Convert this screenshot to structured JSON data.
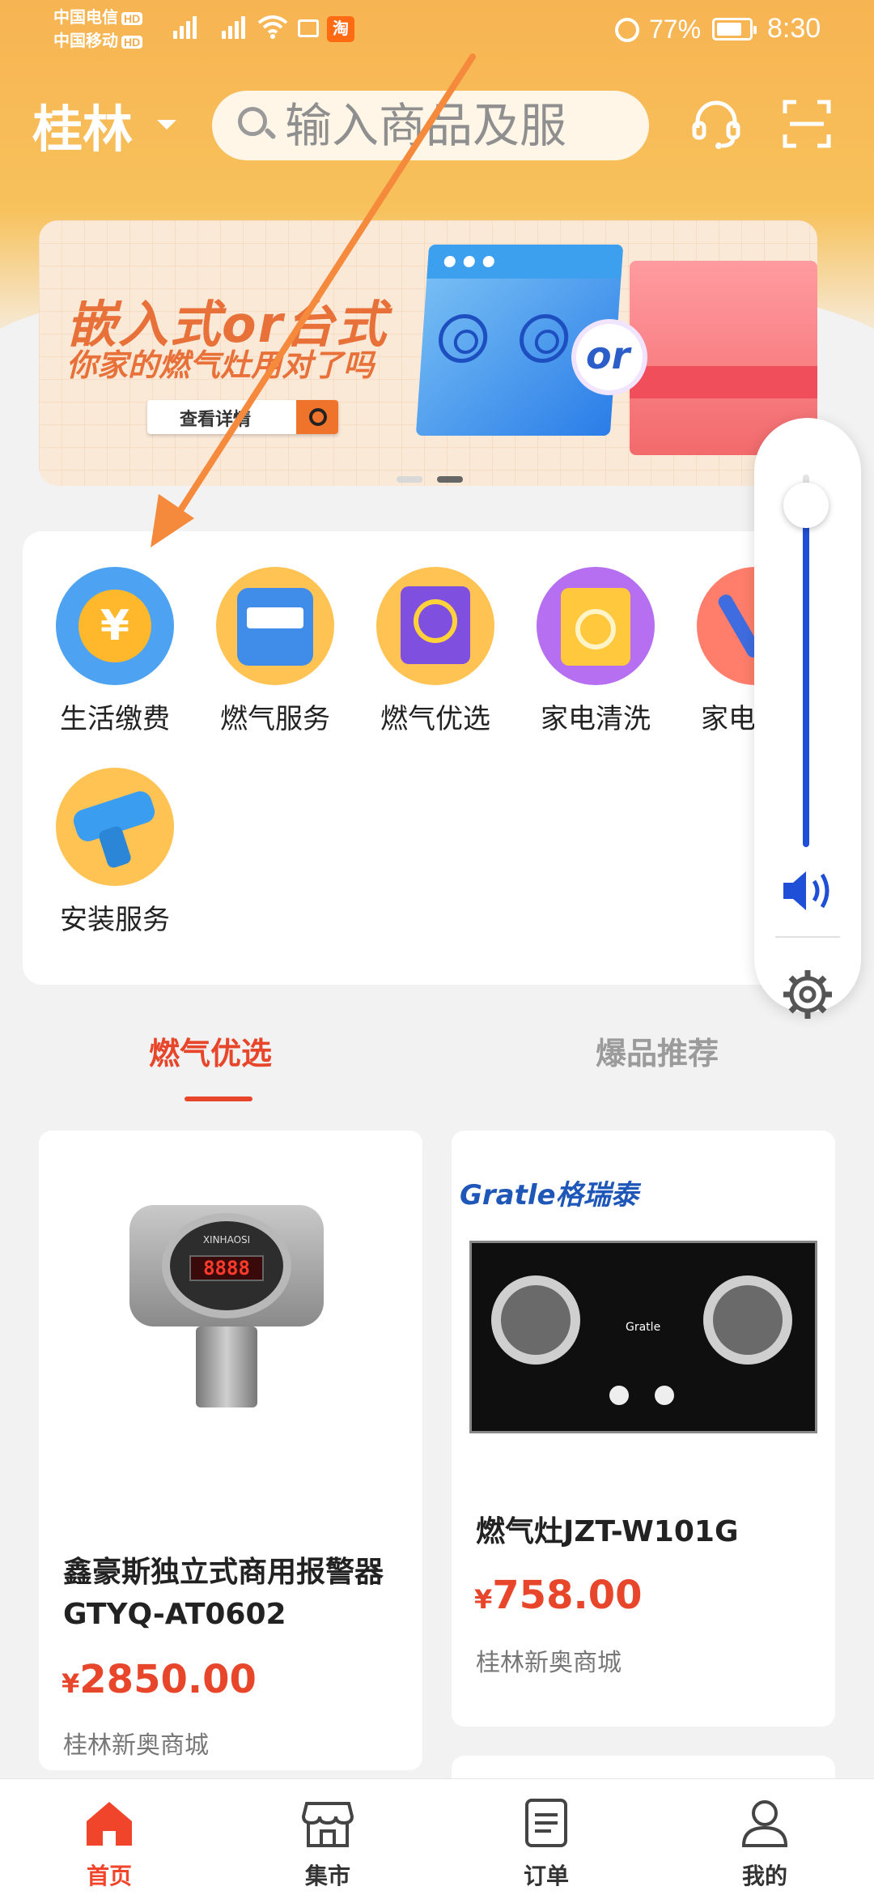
{
  "status_bar": {
    "carrier1": "中国电信",
    "carrier2": "中国移动",
    "hd": "HD",
    "taobao_glyph": "淘",
    "battery": "77%",
    "time": "8:30"
  },
  "header": {
    "city": "桂林",
    "search_placeholder": "输入商品及服",
    "icons": [
      "headset-icon",
      "scan-icon"
    ]
  },
  "banner": {
    "headline": "嵌入式or台式",
    "subline": "你家的燃气灶用对了吗",
    "button_label": "查看详情",
    "or_badge": "or",
    "page_count": 2,
    "active_page": 2
  },
  "categories": [
    {
      "label": "生活缴费",
      "icon": "yuan-icon"
    },
    {
      "label": "燃气服务",
      "icon": "gas-meter-icon"
    },
    {
      "label": "燃气优选",
      "icon": "gas-stove-icon"
    },
    {
      "label": "家电清洗",
      "icon": "washing-machine-icon"
    },
    {
      "label": "家电维修",
      "icon": "wrench-icon"
    },
    {
      "label": "安装服务",
      "icon": "drill-icon"
    }
  ],
  "volume_panel": {
    "level": 0.93,
    "icons": [
      "volume-icon",
      "gear-icon"
    ]
  },
  "tabs": [
    {
      "label": "燃气优选",
      "active": true
    },
    {
      "label": "爆品推荐",
      "active": false
    }
  ],
  "products": [
    {
      "name_line1": "鑫豪斯独立式商用报警器",
      "name_line2": "GTYQ-AT0602",
      "currency": "¥",
      "price": "2850.00",
      "shop": "桂林新奥商城",
      "display_digits": "8888",
      "device_brand": "XINHAOSI"
    },
    {
      "brand": "Gratle格瑞泰",
      "stove_mark": "Gratle",
      "name_line1": "燃气灶JZT-W101G",
      "currency": "¥",
      "price": "758.00",
      "shop": "桂林新奥商城"
    }
  ],
  "bottom_nav": [
    {
      "label": "首页",
      "icon": "home-icon",
      "active": true
    },
    {
      "label": "集市",
      "icon": "store-icon",
      "active": false
    },
    {
      "label": "订单",
      "icon": "order-icon",
      "active": false
    },
    {
      "label": "我的",
      "icon": "user-icon",
      "active": false
    }
  ],
  "colors": {
    "accent": "#e8462a",
    "header": "#f7b452",
    "volume": "#1f4fd6",
    "annotation_arrow": "#f58a3c"
  }
}
